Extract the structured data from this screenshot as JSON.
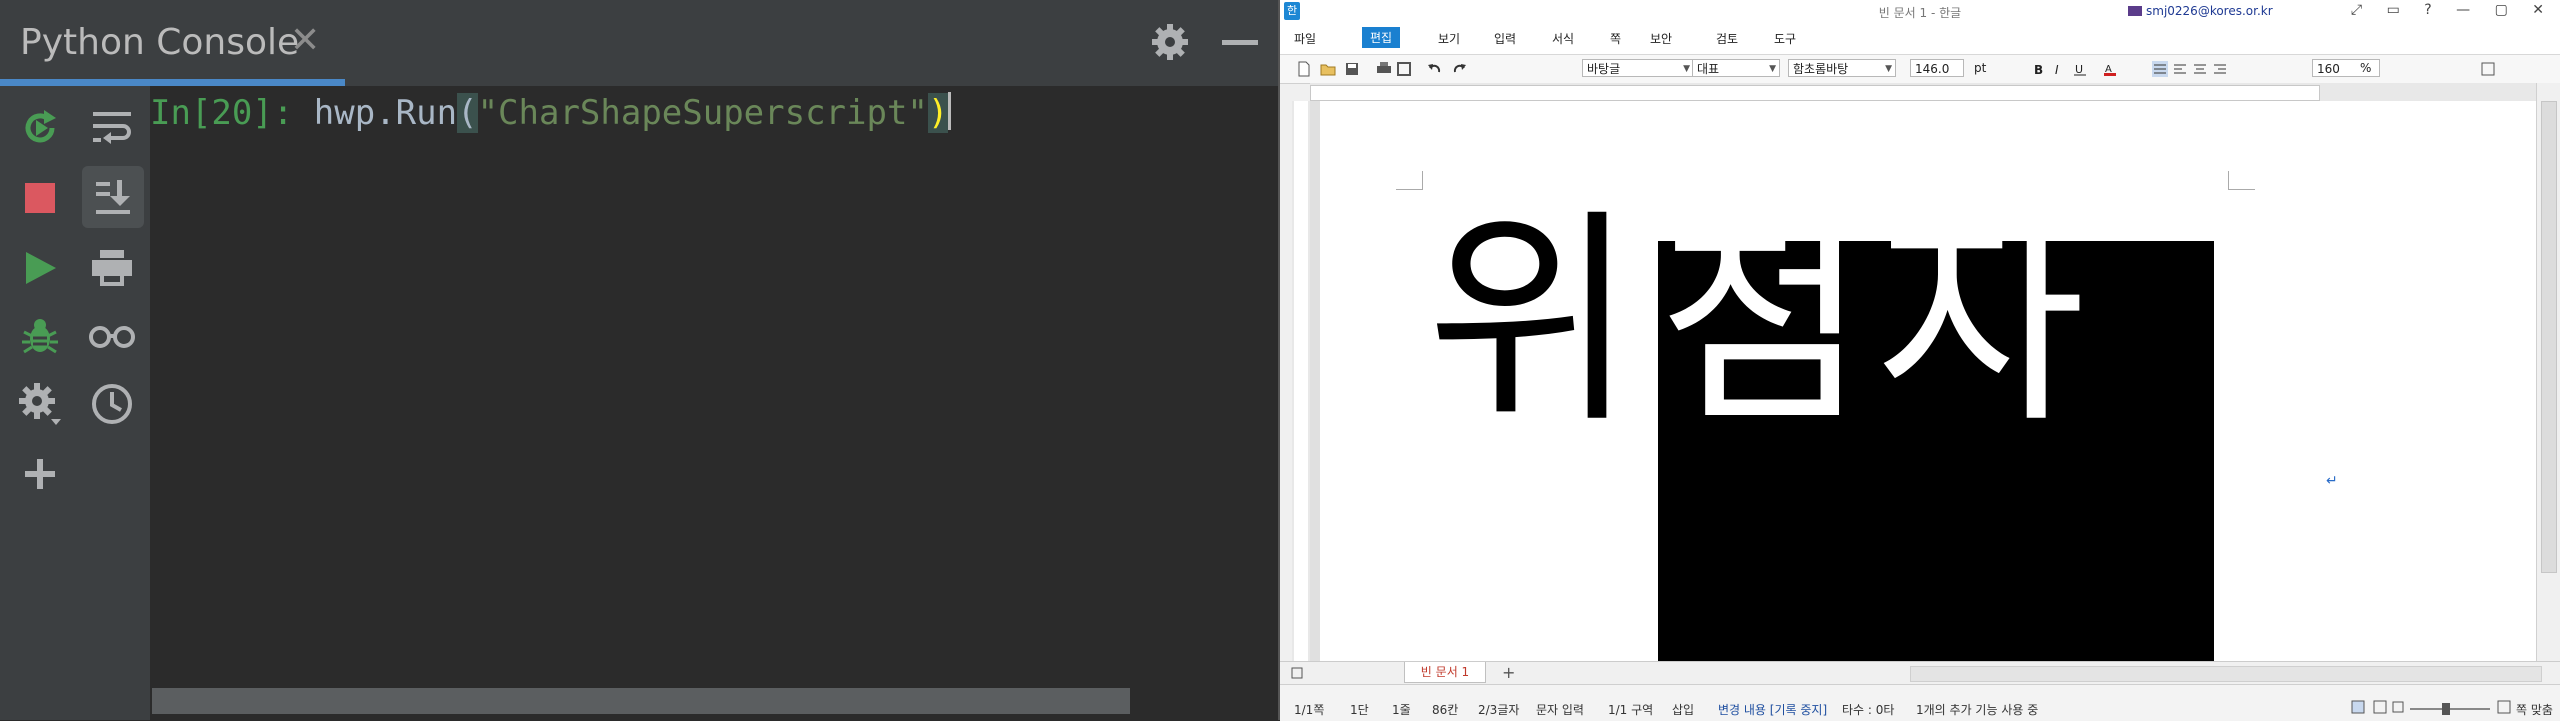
{
  "console": {
    "tab_title": "Python Console",
    "tab_close": "✕",
    "prompt": "In[20]:",
    "code_ident": "hwp.Run",
    "open_paren": "(",
    "string_literal": "\"CharShapeSuperscript\"",
    "close_paren": ")",
    "colors": {
      "prompt": "#499c54",
      "string": "#6a8759",
      "ident": "#a9b7c6",
      "tab_underline": "#4a88c7"
    },
    "toolbar_left": [
      "rerun-icon",
      "stop-icon",
      "run-icon",
      "debug-icon",
      "settings-icon",
      "add-icon"
    ],
    "toolbar_right": [
      "soft-wrap-icon",
      "scroll-to-end-icon",
      "print-icon",
      "glasses-icon",
      "history-icon"
    ]
  },
  "hwp": {
    "app_icon": "한",
    "title": "빈 문서 1 - 한글",
    "account": "smj0226@kores.or.kr",
    "window_controls": "⤢ ▭ ? — ▢ ✕",
    "menu": [
      "파일",
      "편집",
      "보기",
      "입력",
      "서식",
      "쪽",
      "보안",
      "검토",
      "도구"
    ],
    "active_menu": "편집",
    "style_value": "바탕글",
    "lang_value": "대표",
    "font_value": "함초롬바탕",
    "size_value": "146.0",
    "size_unit": "pt",
    "zoom_value": "160",
    "zoom_unit": "%",
    "doc_text_plain": "위",
    "doc_text_selected": "첨자",
    "doc_tab": "빈 문서 1",
    "status": {
      "page": "1/1쪽",
      "column": "1단",
      "line": "1줄",
      "col_pos": "86칸",
      "char": "2/3글자",
      "mode": "문자 입력",
      "section": "1/1 구역",
      "insert": "삽입",
      "track": "변경 내용 [기록 중지]",
      "typing": "타수 : 0타",
      "message": "1개의 추가 기능 사용 중",
      "zoom_label": "쪽 맞춤"
    }
  }
}
